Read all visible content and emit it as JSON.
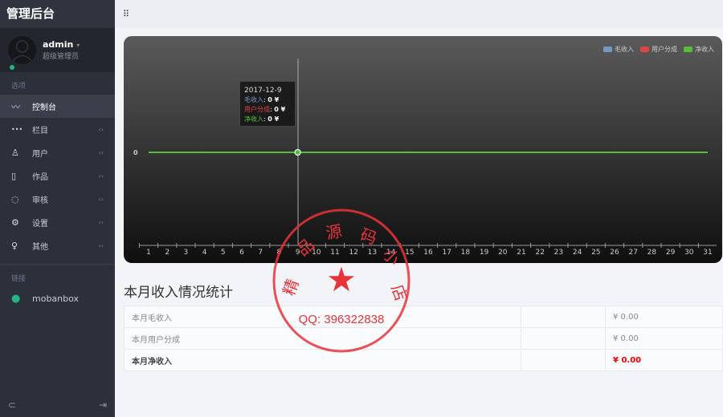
{
  "app": {
    "title": "管理后台"
  },
  "user": {
    "name": "admin",
    "role": "超级管理员"
  },
  "sidebar": {
    "section1": "选项",
    "items": [
      {
        "label": "控制台",
        "icon": "chart-line-icon"
      },
      {
        "label": "栏目",
        "icon": "more-dots-icon"
      },
      {
        "label": "用户",
        "icon": "user-icon"
      },
      {
        "label": "作品",
        "icon": "works-icon"
      },
      {
        "label": "审核",
        "icon": "loading-circle-icon"
      },
      {
        "label": "设置",
        "icon": "gear-icon"
      },
      {
        "label": "其他",
        "icon": "lightbulb-icon"
      }
    ],
    "section2": "链接",
    "link": "mobanbox"
  },
  "chart_data": {
    "type": "line",
    "categories": [
      "1",
      "2",
      "3",
      "4",
      "5",
      "6",
      "7",
      "8",
      "9",
      "10",
      "11",
      "12",
      "13",
      "14",
      "15",
      "16",
      "17",
      "18",
      "19",
      "20",
      "21",
      "22",
      "23",
      "24",
      "25",
      "26",
      "27",
      "28",
      "29",
      "30",
      "31"
    ],
    "series": [
      {
        "name": "毛收入",
        "color": "#7798bf",
        "values": [
          0,
          0,
          0,
          0,
          0,
          0,
          0,
          0,
          0,
          0,
          0,
          0,
          0,
          0,
          0,
          0,
          0,
          0,
          0,
          0,
          0,
          0,
          0,
          0,
          0,
          0,
          0,
          0,
          0,
          0,
          0
        ]
      },
      {
        "name": "用户分成",
        "color": "#dd4444",
        "values": [
          0,
          0,
          0,
          0,
          0,
          0,
          0,
          0,
          0,
          0,
          0,
          0,
          0,
          0,
          0,
          0,
          0,
          0,
          0,
          0,
          0,
          0,
          0,
          0,
          0,
          0,
          0,
          0,
          0,
          0,
          0
        ]
      },
      {
        "name": "净收入",
        "color": "#55bf3b",
        "values": [
          0,
          0,
          0,
          0,
          0,
          0,
          0,
          0,
          0,
          0,
          0,
          0,
          0,
          0,
          0,
          0,
          0,
          0,
          0,
          0,
          0,
          0,
          0,
          0,
          0,
          0,
          0,
          0,
          0,
          0,
          0
        ]
      }
    ],
    "yticks": [
      "0"
    ],
    "legend": "top-right",
    "tooltip": {
      "date": "2017-12-9",
      "rows": [
        {
          "label": "毛收入",
          "value": "0 ¥"
        },
        {
          "label": "用户分成",
          "value": "0 ¥"
        },
        {
          "label": "净收入",
          "value": "0 ¥"
        }
      ]
    }
  },
  "summary": {
    "title": "本月收入情况统计",
    "rows": [
      {
        "label": "本月毛收入",
        "value": "¥ 0.00"
      },
      {
        "label": "本月用户分成",
        "value": "¥ 0.00"
      },
      {
        "label": "本月净收入",
        "value": "¥ 0.00"
      }
    ]
  },
  "stamp": {
    "text": "精品源码小店",
    "qq": "QQ: 396322838"
  }
}
